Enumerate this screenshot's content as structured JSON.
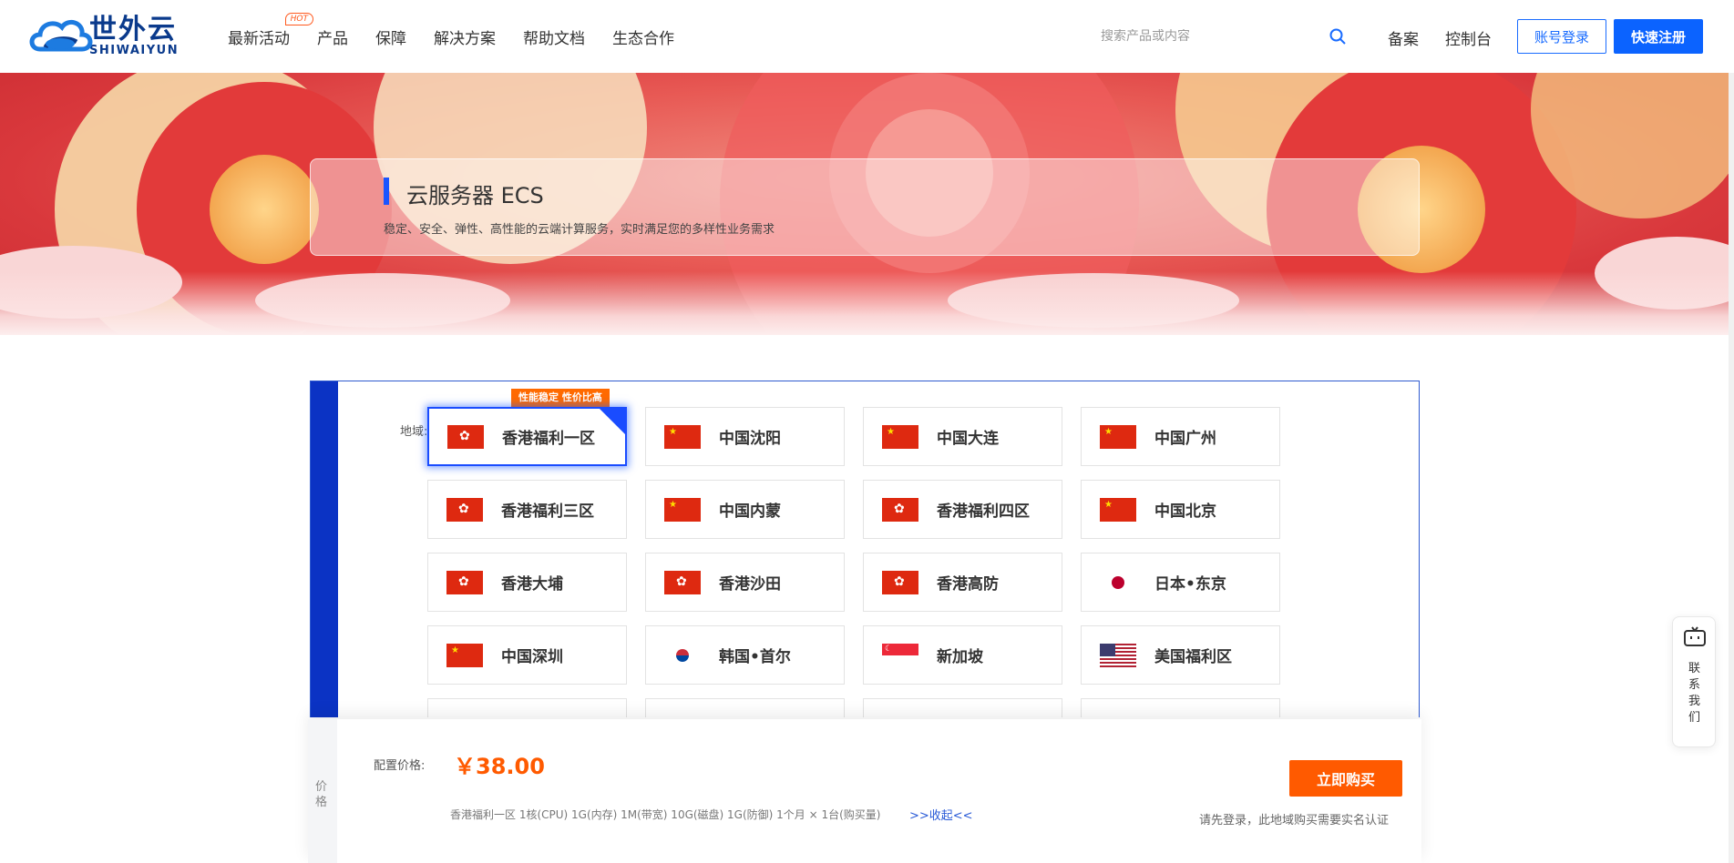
{
  "brand": {
    "name_cn": "世外云",
    "name_en": "SHIWAIYUN"
  },
  "nav": {
    "items": [
      {
        "label": "最新活动",
        "badge": "HOT"
      },
      {
        "label": "产品"
      },
      {
        "label": "保障"
      },
      {
        "label": "解决方案"
      },
      {
        "label": "帮助文档"
      },
      {
        "label": "生态合作"
      }
    ]
  },
  "search": {
    "placeholder": "搜索产品或内容"
  },
  "header_links": {
    "beian": "备案",
    "console": "控制台",
    "login": "账号登录",
    "register": "快速注册"
  },
  "banner": {
    "title": "云服务器 ECS",
    "subtitle": "稳定、安全、弹性、高性能的云端计算服务，实时满足您的多样性业务需求"
  },
  "region": {
    "label": "地域:",
    "badge": "性能稳定 性价比高",
    "tiles": [
      {
        "name": "香港福利一区",
        "flag": "hk",
        "selected": true
      },
      {
        "name": "中国沈阳",
        "flag": "cn"
      },
      {
        "name": "中国大连",
        "flag": "cn"
      },
      {
        "name": "中国广州",
        "flag": "cn"
      },
      {
        "name": "香港福利三区",
        "flag": "hk"
      },
      {
        "name": "中国内蒙",
        "flag": "cn"
      },
      {
        "name": "香港福利四区",
        "flag": "hk"
      },
      {
        "name": "中国北京",
        "flag": "cn"
      },
      {
        "name": "香港大埔",
        "flag": "hk"
      },
      {
        "name": "香港沙田",
        "flag": "hk"
      },
      {
        "name": "香港高防",
        "flag": "hk"
      },
      {
        "name": "日本•东京",
        "flag": "jp"
      },
      {
        "name": "中国深圳",
        "flag": "cn"
      },
      {
        "name": "韩国•首尔",
        "flag": "kr"
      },
      {
        "name": "新加坡",
        "flag": "sg"
      },
      {
        "name": "美国福利区",
        "flag": "us"
      }
    ]
  },
  "price": {
    "side_label": "价格",
    "label": "配置价格:",
    "value": "￥38.00",
    "config": "香港福利一区  1核(CPU)  1G(内存)  1M(带宽)  10G(磁盘)  1G(防御)  1个月 × 1台(购买量)",
    "collapse": ">>收起<<",
    "buy": "立即购买",
    "note": "请先登录，此地域购买需要实名认证"
  },
  "contact": {
    "label": "联系我们"
  },
  "colors": {
    "primary": "#1a6cff",
    "accent": "#ff5a00",
    "side": "#0b33c4"
  }
}
